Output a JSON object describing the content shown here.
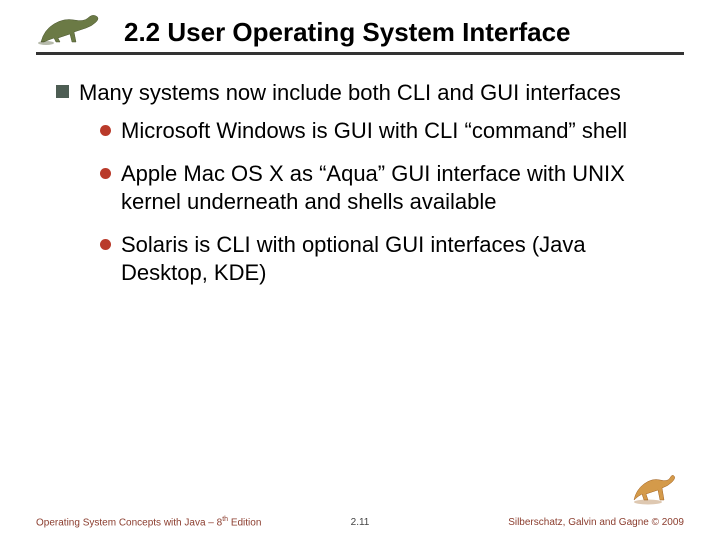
{
  "header": {
    "title": "2.2 User Operating System Interface"
  },
  "main": {
    "bullet": "Many systems now include both CLI and GUI interfaces",
    "subs": [
      "Microsoft Windows is GUI with CLI “command” shell",
      "Apple Mac OS X as “Aqua” GUI interface with UNIX kernel underneath and shells available",
      "Solaris is CLI with optional GUI interfaces (Java Desktop, KDE)"
    ]
  },
  "footer": {
    "left_prefix": "Operating System Concepts with Java – 8",
    "left_sup": "th",
    "left_suffix": " Edition",
    "center": "2.11",
    "right": "Silberschatz, Galvin and Gagne © 2009"
  }
}
